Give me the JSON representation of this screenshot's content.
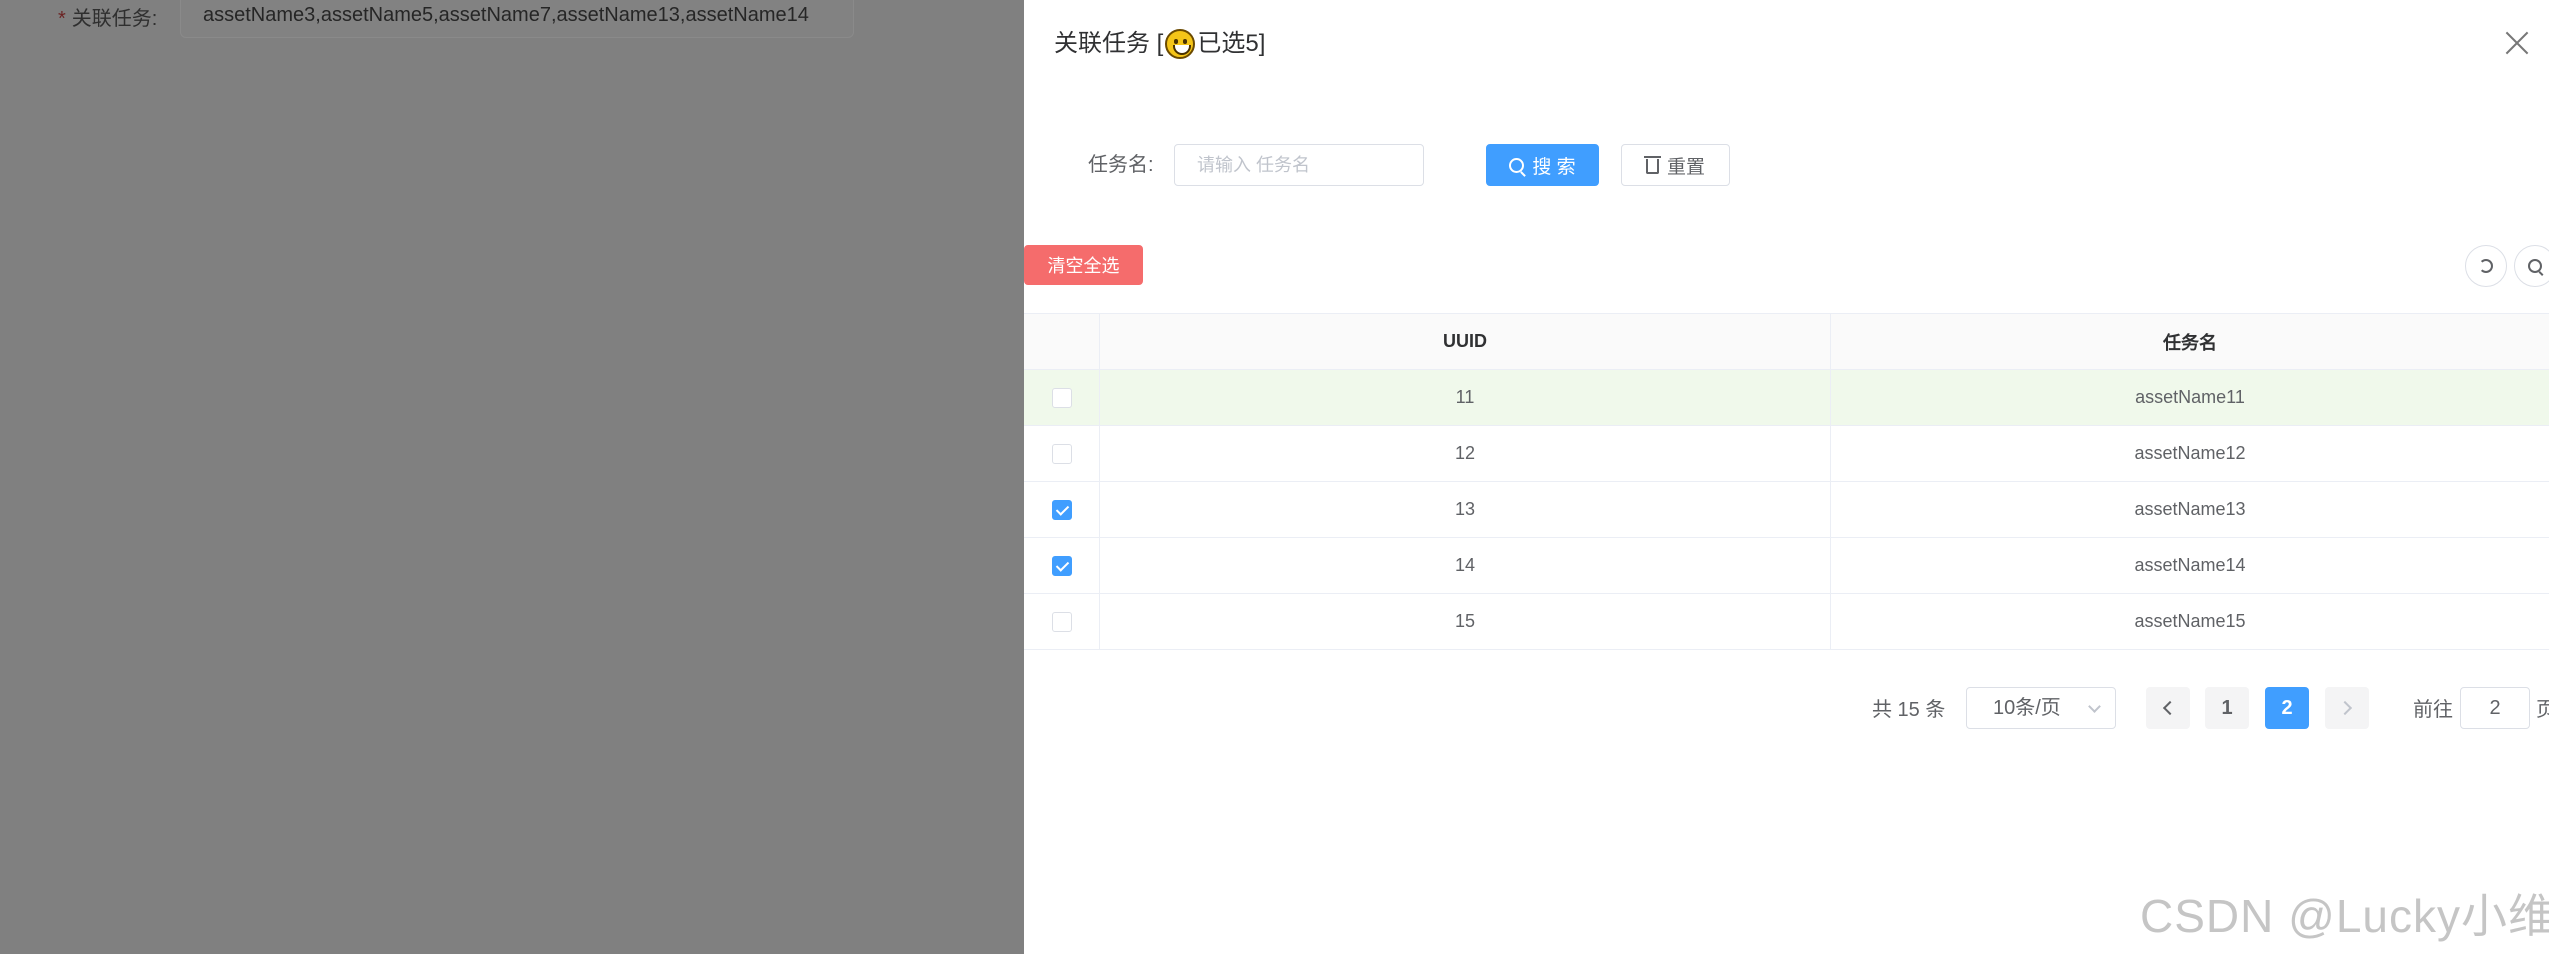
{
  "background_form": {
    "required_mark": "*",
    "label": "关联任务:",
    "value": "assetName3,assetName5,assetName7,assetName13,assetName14"
  },
  "drawer": {
    "title_prefix": "关联任务 [",
    "title_suffix": "已选5]",
    "title_icon": "smiley-face-icon",
    "close_icon": "close-icon"
  },
  "search": {
    "label": "任务名:",
    "placeholder": "请输入 任务名",
    "value": "",
    "search_label": "搜 索",
    "reset_label": "重置"
  },
  "toolbar": {
    "clear_all_label": "清空全选",
    "refresh_icon": "refresh-icon",
    "search_icon": "search-icon"
  },
  "table": {
    "columns": [
      "",
      "UUID",
      "任务名"
    ],
    "rows": [
      {
        "uuid": "11",
        "name": "assetName11",
        "checked": false
      },
      {
        "uuid": "12",
        "name": "assetName12",
        "checked": false
      },
      {
        "uuid": "13",
        "name": "assetName13",
        "checked": true
      },
      {
        "uuid": "14",
        "name": "assetName14",
        "checked": true
      },
      {
        "uuid": "15",
        "name": "assetName15",
        "checked": false
      }
    ]
  },
  "pagination": {
    "total_text": "共 15 条",
    "page_size": "10条/页",
    "pages": [
      "1",
      "2"
    ],
    "current_page": "2",
    "goto_label": "前往",
    "goto_value": "2",
    "page_unit": "页"
  },
  "colors": {
    "primary": "#409eff",
    "danger": "#f56c6c",
    "highlight_row": "#f0f9eb"
  },
  "watermark": "CSDN @Lucky小维"
}
